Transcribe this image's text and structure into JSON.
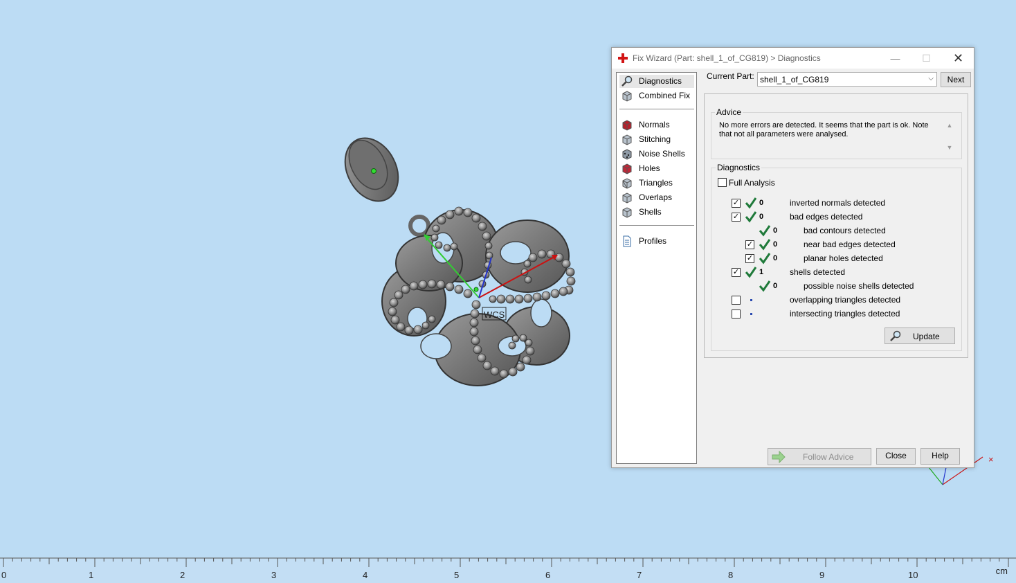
{
  "dialog": {
    "title": "Fix Wizard (Part: shell_1_of_CG819) > Diagnostics",
    "window_controls": {
      "minimize": "—",
      "maximize": "☐",
      "close": "✕"
    },
    "nav": {
      "top_items": [
        {
          "label": "Diagnostics",
          "icon": "magnifier-icon",
          "selected": true
        },
        {
          "label": "Combined Fix",
          "icon": "cube-icon"
        }
      ],
      "fix_items": [
        {
          "label": "Normals",
          "icon": "normals-cube-icon"
        },
        {
          "label": "Stitching",
          "icon": "stitching-cube-icon"
        },
        {
          "label": "Noise Shells",
          "icon": "noise-shells-icon"
        },
        {
          "label": "Holes",
          "icon": "holes-cube-icon"
        },
        {
          "label": "Triangles",
          "icon": "triangles-cube-icon"
        },
        {
          "label": "Overlaps",
          "icon": "overlaps-cube-icon"
        },
        {
          "label": "Shells",
          "icon": "shells-cube-icon"
        }
      ],
      "bottom_items": [
        {
          "label": "Profiles",
          "icon": "document-icon"
        }
      ]
    },
    "current_part_label": "Current Part:",
    "current_part_value": "shell_1_of_CG819",
    "next_button": "Next",
    "advice": {
      "title": "Advice",
      "text": "No more errors are detected. It seems that the part is ok. Note that not all parameters were analysed."
    },
    "diagnostics": {
      "title": "Diagnostics",
      "full_analysis_label": "Full Analysis",
      "full_analysis_checked": false,
      "rows": [
        {
          "checked": true,
          "status": "ok",
          "count": "0",
          "label": "inverted normals detected",
          "indent": 0,
          "has_checkbox": true
        },
        {
          "checked": true,
          "status": "ok",
          "count": "0",
          "label": "bad edges detected",
          "indent": 0,
          "has_checkbox": true
        },
        {
          "checked": null,
          "status": "ok",
          "count": "0",
          "label": "bad contours detected",
          "indent": 1,
          "has_checkbox": false
        },
        {
          "checked": true,
          "status": "ok",
          "count": "0",
          "label": "near bad edges detected",
          "indent": 1,
          "has_checkbox": true
        },
        {
          "checked": true,
          "status": "ok",
          "count": "0",
          "label": "planar holes detected",
          "indent": 1,
          "has_checkbox": true
        },
        {
          "checked": true,
          "status": "ok",
          "count": "1",
          "label": "shells detected",
          "indent": 0,
          "has_checkbox": true
        },
        {
          "checked": null,
          "status": "ok",
          "count": "0",
          "label": "possible noise shells detected",
          "indent": 1,
          "has_checkbox": false
        },
        {
          "checked": false,
          "status": "unknown",
          "count": "",
          "label": "overlapping triangles detected",
          "indent": 0,
          "has_checkbox": true
        },
        {
          "checked": false,
          "status": "unknown",
          "count": "",
          "label": "intersecting triangles detected",
          "indent": 0,
          "has_checkbox": true
        }
      ],
      "update_button": "Update"
    },
    "footer": {
      "follow_advice": "Follow Advice",
      "close": "Close",
      "help": "Help"
    }
  },
  "viewport": {
    "wcs_label": "WCS",
    "axes": {
      "x_color": "#cc1111",
      "y_color": "#22aa22",
      "z_color": "#2233cc"
    }
  },
  "ruler": {
    "labels": [
      "0",
      "1",
      "2",
      "3",
      "4",
      "5",
      "6",
      "7",
      "8",
      "9",
      "10"
    ],
    "unit": "cm"
  },
  "colors": {
    "background": "#bcdcf4",
    "ok_tick": "#1f7a3a",
    "model": "#7a7a7a"
  }
}
